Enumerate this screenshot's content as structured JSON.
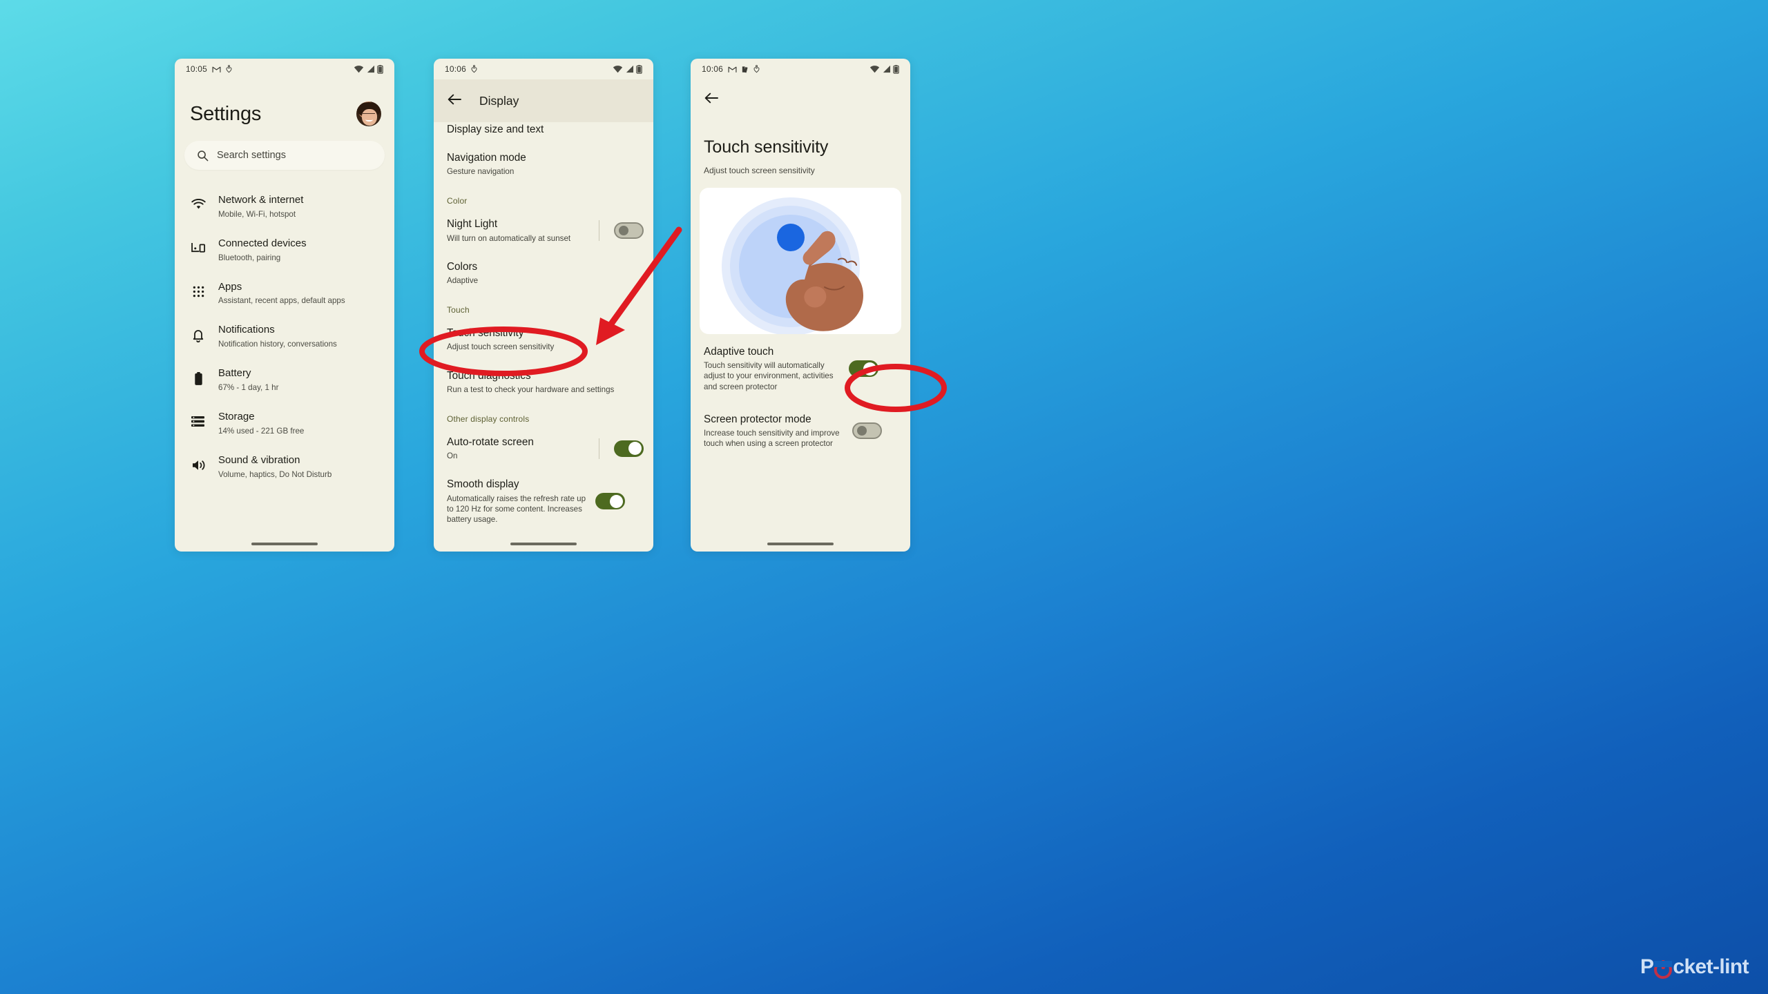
{
  "background": {
    "gradient_from": "#5ddbe8",
    "gradient_to": "#0d4fa8"
  },
  "watermark": {
    "brand_part1": "P",
    "brand_part2": "cket-lint",
    "color": "#cfe0f5",
    "accent": "#c03047"
  },
  "colors": {
    "phone_bg": "#f2f1e4",
    "appbar_bg": "#e8e5d6",
    "toggle_on": "#4d6a20",
    "toggle_off": "#c4c3b2",
    "section_header": "#5d6033",
    "annotation_red": "#e01b22"
  },
  "phone1": {
    "status": {
      "time": "10:05",
      "icons": [
        "gmail-icon",
        "heart-pin-icon"
      ],
      "right_icons": [
        "wifi-icon",
        "signal-icon",
        "battery-icon"
      ]
    },
    "avatar_label": "account-avatar",
    "title": "Settings",
    "search": {
      "placeholder": "Search settings",
      "icon": "search-icon"
    },
    "items": [
      {
        "icon": "wifi-icon",
        "title": "Network & internet",
        "subtitle": "Mobile, Wi-Fi, hotspot"
      },
      {
        "icon": "devices-icon",
        "title": "Connected devices",
        "subtitle": "Bluetooth, pairing"
      },
      {
        "icon": "apps-grid-icon",
        "title": "Apps",
        "subtitle": "Assistant, recent apps, default apps"
      },
      {
        "icon": "bell-icon",
        "title": "Notifications",
        "subtitle": "Notification history, conversations"
      },
      {
        "icon": "battery-icon",
        "title": "Battery",
        "subtitle": "67% - 1 day, 1 hr"
      },
      {
        "icon": "storage-icon",
        "title": "Storage",
        "subtitle": "14% used - 221 GB free"
      },
      {
        "icon": "volume-icon",
        "title": "Sound & vibration",
        "subtitle": "Volume, haptics, Do Not Disturb"
      }
    ]
  },
  "phone2": {
    "status": {
      "time": "10:06",
      "icons": [
        "gmail-icon",
        "heart-pin-icon"
      ],
      "right_icons": [
        "wifi-icon",
        "signal-icon",
        "battery-icon"
      ]
    },
    "appbar": {
      "back": "back-arrow-icon",
      "title": "Display"
    },
    "partial_top_item": "Display size and text",
    "rows": [
      {
        "kind": "item",
        "title": "Navigation mode",
        "subtitle": "Gesture navigation"
      },
      {
        "kind": "header",
        "title": "Color"
      },
      {
        "kind": "toggle",
        "title": "Night Light",
        "subtitle": "Will turn on automatically at sunset",
        "state": "off"
      },
      {
        "kind": "item",
        "title": "Colors",
        "subtitle": "Adaptive"
      },
      {
        "kind": "header",
        "title": "Touch"
      },
      {
        "kind": "item",
        "title": "Touch sensitivity",
        "subtitle": "Adjust touch screen sensitivity",
        "highlighted": true
      },
      {
        "kind": "item",
        "title": "Touch diagnostics",
        "subtitle": "Run a test to check your hardware and settings"
      },
      {
        "kind": "header",
        "title": "Other display controls"
      },
      {
        "kind": "toggle",
        "title": "Auto-rotate screen",
        "subtitle": "On",
        "state": "on"
      },
      {
        "kind": "toggle",
        "title": "Smooth display",
        "subtitle": "Automatically raises the refresh rate up to 120 Hz for some content. Increases battery usage.",
        "state": "on"
      }
    ]
  },
  "phone3": {
    "status": {
      "time": "10:06",
      "icons": [
        "gmail-icon",
        "books-icon",
        "heart-pin-icon"
      ],
      "right_icons": [
        "wifi-icon",
        "signal-icon",
        "battery-icon"
      ]
    },
    "appbar": {
      "back": "back-arrow-icon",
      "title": ""
    },
    "title": "Touch sensitivity",
    "subtitle": "Adjust touch screen sensitivity",
    "illustration": "hand-tap-ripple-illustration",
    "rows": [
      {
        "kind": "toggle",
        "title": "Adaptive touch",
        "subtitle": "Touch sensitivity will automatically adjust to your environment, activities and screen protector",
        "state": "on",
        "highlighted": true
      },
      {
        "kind": "toggle",
        "title": "Screen protector mode",
        "subtitle": "Increase touch sensitivity and improve touch when using a screen protector",
        "state": "off"
      }
    ]
  },
  "annotations": [
    {
      "name": "ellipse-touch-sensitivity",
      "shape": "ellipse",
      "color": "#e01b22"
    },
    {
      "name": "arrow-to-touch-sensitivity",
      "shape": "arrow",
      "color": "#e01b22"
    },
    {
      "name": "ellipse-adaptive-touch-toggle",
      "shape": "ellipse",
      "color": "#e01b22"
    }
  ]
}
